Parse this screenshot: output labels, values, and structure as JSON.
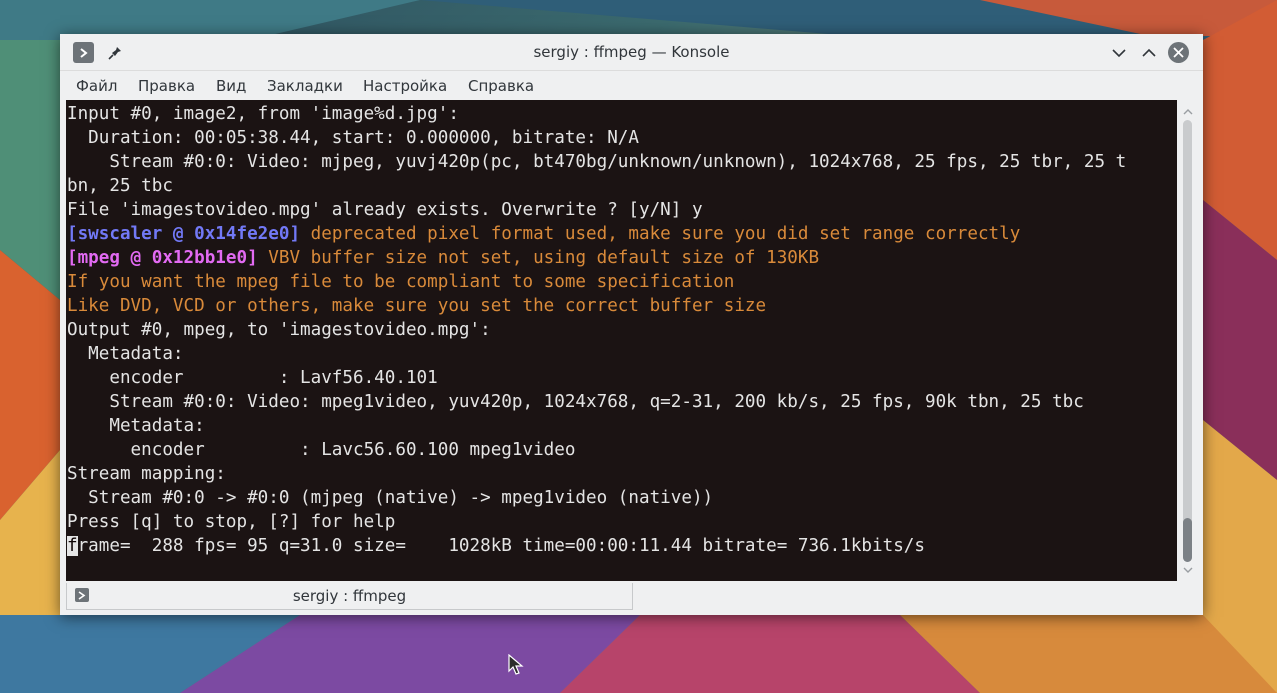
{
  "window": {
    "title": "sergiy : ffmpeg — Konsole"
  },
  "menubar": {
    "items": [
      "Файл",
      "Правка",
      "Вид",
      "Закладки",
      "Настройка",
      "Справка"
    ]
  },
  "terminal": {
    "lines": [
      "Input #0, image2, from 'image%d.jpg':",
      "  Duration: 00:05:38.44, start: 0.000000, bitrate: N/A",
      "    Stream #0:0: Video: mjpeg, yuvj420p(pc, bt470bg/unknown/unknown), 1024x768, 25 fps, 25 tbr, 25 t",
      "bn, 25 tbc",
      "File 'imagestovideo.mpg' already exists. Overwrite ? [y/N] y",
      {
        "tag": "[swscaler @ 0x14fe2e0]",
        "msg": " deprecated pixel format used, make sure you did set range correctly"
      },
      {
        "tag": "[mpeg @ 0x12bb1e0]",
        "msg": " VBV buffer size not set, using default size of 130KB"
      },
      "If you want the mpeg file to be compliant to some specification",
      "Like DVD, VCD or others, make sure you set the correct buffer size",
      "Output #0, mpeg, to 'imagestovideo.mpg':",
      "  Metadata:",
      "    encoder         : Lavf56.40.101",
      "    Stream #0:0: Video: mpeg1video, yuv420p, 1024x768, q=2-31, 200 kb/s, 25 fps, 90k tbn, 25 tbc",
      "    Metadata:",
      "      encoder         : Lavc56.60.100 mpeg1video",
      "Stream mapping:",
      "  Stream #0:0 -> #0:0 (mjpeg (native) -> mpeg1video (native))",
      "Press [q] to stop, [?] for help",
      {
        "cursor": "f",
        "rest": "rame=  288 fps= 95 q=31.0 size=    1028kB time=00:00:11.44 bitrate= 736.1kbits/s"
      }
    ]
  },
  "tabbar": {
    "tab_label": "sergiy : ffmpeg"
  },
  "colors": {
    "terminal_bg": "#0e0404",
    "terminal_fg": "#e4e4e4",
    "swscaler_tag": "#7279f6",
    "mpeg_tag": "#e26af2",
    "warning": "#d98a3a",
    "chrome": "#eff0f1"
  },
  "icons": {
    "titlebar": [
      "terminal-icon",
      "pin-icon",
      "minimize-icon",
      "maximize-icon",
      "close-icon"
    ],
    "tab": "terminal-icon",
    "cursor": "mouse-pointer-icon"
  }
}
